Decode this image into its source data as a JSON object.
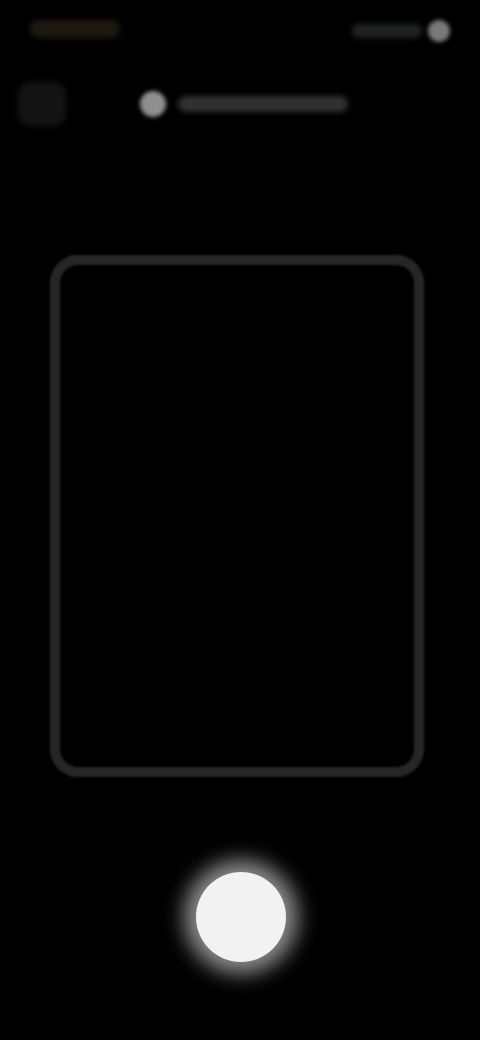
{
  "status_bar": {
    "icons": [
      "signal-icon",
      "battery-icon"
    ]
  },
  "header": {
    "back_icon": "back-icon",
    "title_icon": "camera-icon"
  },
  "capture": {
    "frame_color": "#262626",
    "shutter_color": "#f2f2f2"
  }
}
